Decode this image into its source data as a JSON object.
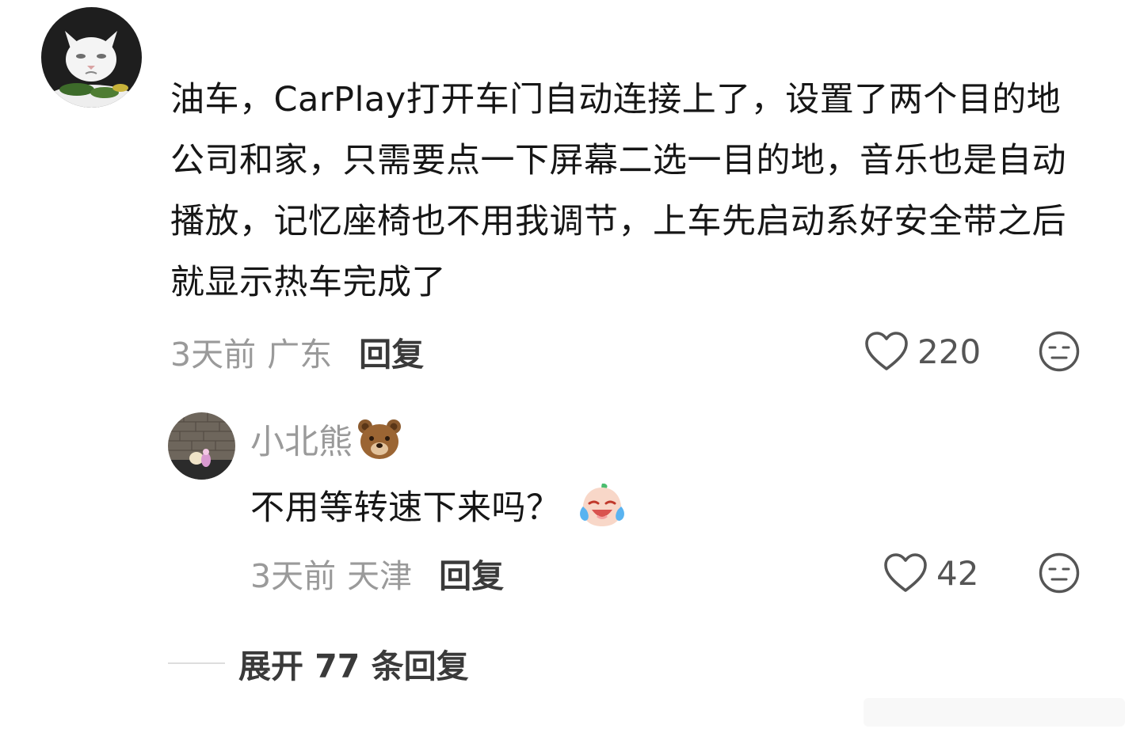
{
  "main_comment": {
    "text": "油车，CarPlay打开车门自动连接上了，设置了两个目的地公司和家，只需要点一下屏幕二选一目的地，音乐也是自动播放，记忆座椅也不用我调节，上车先启动系好安全带之后就显示热车完成了",
    "time": "3天前",
    "location": "广东",
    "reply_label": "回复",
    "likes": "220"
  },
  "reply_comment": {
    "username": "小北熊",
    "text": "不用等转速下来吗？",
    "time": "3天前",
    "location": "天津",
    "reply_label": "回复",
    "likes": "42"
  },
  "expand": {
    "label": "展开 77 条回复"
  },
  "icons": {
    "like": "heart-outline-icon",
    "dislike": "neutral-face-icon",
    "username_emoji": "bear-face-icon",
    "reply_emoji": "crying-laughing-face-icon"
  },
  "colors": {
    "text_primary": "#161616",
    "text_secondary": "#9a9a9a",
    "action": "#3a3a3a",
    "icon": "#555555"
  }
}
